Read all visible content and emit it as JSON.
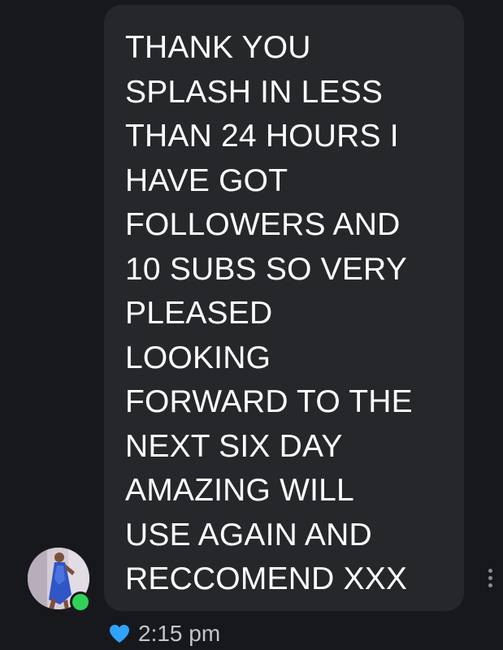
{
  "message": {
    "text": "THANK YOU\nSPLASH IN LESS\nTHAN 24 HOURS I\nHAVE GOT\nFOLLOWERS AND\n10 SUBS SO VERY\nPLEASED\nLOOKING\nFORWARD TO THE\nNEXT SIX DAY\nAMAZING WILL\nUSE AGAIN AND\nRECCOMEND XXX"
  },
  "status": {
    "time": "2:15 pm",
    "reaction_icon": "heart-icon",
    "online": true
  },
  "colors": {
    "background": "#17181c",
    "bubble": "#25272b",
    "text": "#ffffff",
    "heart": "#2fa3ff",
    "online": "#31d158"
  }
}
